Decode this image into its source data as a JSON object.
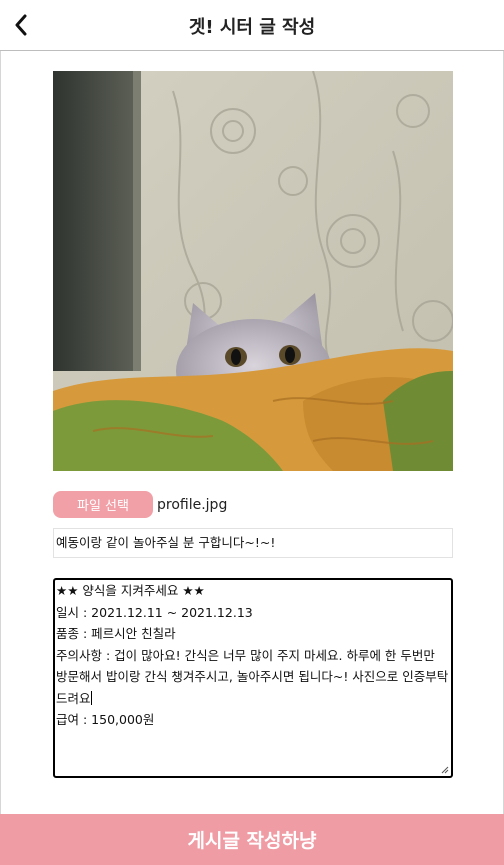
{
  "header": {
    "title": "겟! 시터 글 작성",
    "back_icon": "chevron-left-icon"
  },
  "photo": {
    "alt": "profile.jpg"
  },
  "file": {
    "button_label": "파일 선택",
    "file_name": "profile.jpg"
  },
  "post": {
    "title_value": "예동이랑 같이 놀아주실 분 구합니다~!~!",
    "content_lines": [
      "★★ 양식을 지켜주세요 ★★",
      "일시 : 2021.12.11 ~ 2021.12.13",
      "품종 : 페르시안 친칠라",
      "주의사항 : 겁이 많아요! 간식은 너무 많이 주지 마세요. 하루에 한 두번만 방문해서 밥이랑 간식 챙겨주시고, 놀아주시면 됩니다~! 사진으로 인증부탁드려요",
      "급여 : 150,000원"
    ]
  },
  "submit": {
    "label": "게시글 작성하냥"
  },
  "colors": {
    "accent": "#f09ca5",
    "file_button": "#f1a0a7"
  }
}
